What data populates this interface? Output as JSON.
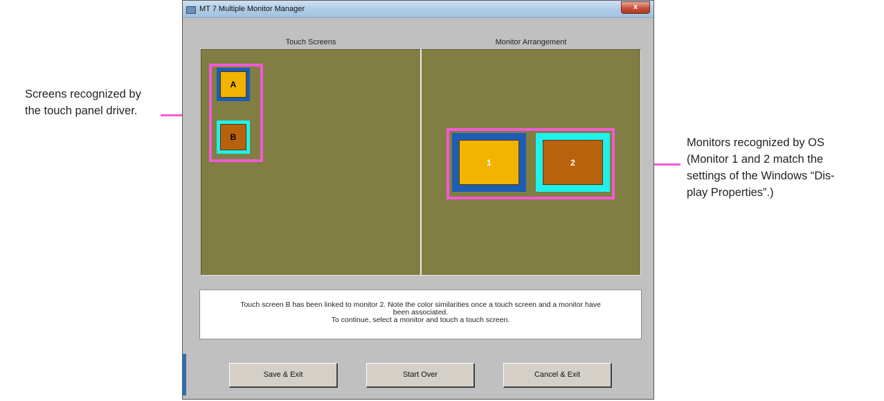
{
  "annotations": {
    "left_line1": "Screens recognized by",
    "left_line2": "the touch panel driver.",
    "right_line1": "Monitors recognized by OS",
    "right_line2": "(Monitor 1 and 2 match the",
    "right_line3": "settings of the Windows “Dis-",
    "right_line4": "play Properties”.)"
  },
  "window": {
    "title": "MT 7 Multiple Monitor Manager",
    "close_glyph": "x"
  },
  "panels": {
    "touch_label": "Touch Screens",
    "monitor_label": "Monitor Arrangement"
  },
  "touch_screens": [
    {
      "label": "A",
      "fill": "#f2b400",
      "border": "#1c5db5"
    },
    {
      "label": "B",
      "fill": "#b8620e",
      "border": "#20f0ee"
    }
  ],
  "monitors": [
    {
      "label": "1",
      "fill": "#f2b400",
      "border": "#1c5db5"
    },
    {
      "label": "2",
      "fill": "#b8620e",
      "border": "#20f0ee"
    }
  ],
  "message": {
    "line1": "Touch screen B has been linked to monitor 2. Note the color similarities once a touch screen and a monitor have",
    "line2": "been associated.",
    "line3": "To continue, select a monitor and touch a touch screen."
  },
  "buttons": {
    "save": "Save & Exit",
    "start_over": "Start Over",
    "cancel": "Cancel & Exit"
  },
  "colors": {
    "pane_bg": "#807e42",
    "highlight": "#f35ad6",
    "window_bg": "#c0c0c0"
  }
}
